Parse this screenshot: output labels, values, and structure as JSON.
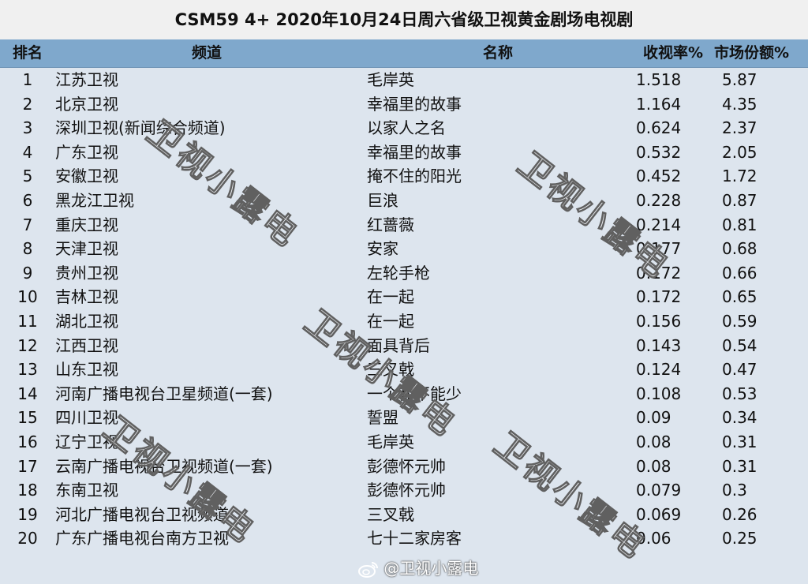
{
  "title": "CSM59 4+ 2020年10月24日周六省级卫视黄金剧场电视剧",
  "header": {
    "rank": "排名",
    "channel": "频道",
    "name": "名称",
    "rating": "收视率%",
    "share": "市场份额%"
  },
  "rows": [
    {
      "rank": "1",
      "channel": "江苏卫视",
      "name": "毛岸英",
      "rating": "1.518",
      "share": "5.87"
    },
    {
      "rank": "2",
      "channel": "北京卫视",
      "name": "幸福里的故事",
      "rating": "1.164",
      "share": "4.35"
    },
    {
      "rank": "3",
      "channel": "深圳卫视(新闻综合频道)",
      "name": "以家人之名",
      "rating": "0.624",
      "share": "2.37"
    },
    {
      "rank": "4",
      "channel": "广东卫视",
      "name": "幸福里的故事",
      "rating": "0.532",
      "share": "2.05"
    },
    {
      "rank": "5",
      "channel": "安徽卫视",
      "name": "掩不住的阳光",
      "rating": "0.452",
      "share": "1.72"
    },
    {
      "rank": "6",
      "channel": "黑龙江卫视",
      "name": "巨浪",
      "rating": "0.228",
      "share": "0.87"
    },
    {
      "rank": "7",
      "channel": "重庆卫视",
      "name": "红蔷薇",
      "rating": "0.214",
      "share": "0.81"
    },
    {
      "rank": "8",
      "channel": "天津卫视",
      "name": "安家",
      "rating": "0.177",
      "share": "0.68"
    },
    {
      "rank": "9",
      "channel": "贵州卫视",
      "name": "左轮手枪",
      "rating": "0.172",
      "share": "0.66"
    },
    {
      "rank": "10",
      "channel": "吉林卫视",
      "name": "在一起",
      "rating": "0.172",
      "share": "0.65"
    },
    {
      "rank": "11",
      "channel": "湖北卫视",
      "name": "在一起",
      "rating": "0.156",
      "share": "0.59"
    },
    {
      "rank": "12",
      "channel": "江西卫视",
      "name": "面具背后",
      "rating": "0.143",
      "share": "0.54"
    },
    {
      "rank": "13",
      "channel": "山东卫视",
      "name": "三叉戟",
      "rating": "0.124",
      "share": "0.47"
    },
    {
      "rank": "14",
      "channel": "河南广播电视台卫星频道(一套)",
      "name": "一个都不能少",
      "rating": "0.108",
      "share": "0.53"
    },
    {
      "rank": "15",
      "channel": "四川卫视",
      "name": "誓盟",
      "rating": "0.09",
      "share": "0.34"
    },
    {
      "rank": "16",
      "channel": "辽宁卫视",
      "name": "毛岸英",
      "rating": "0.08",
      "share": "0.31"
    },
    {
      "rank": "17",
      "channel": "云南广播电视台卫视频道(一套)",
      "name": "彭德怀元帅",
      "rating": "0.08",
      "share": "0.31"
    },
    {
      "rank": "18",
      "channel": "东南卫视",
      "name": "彭德怀元帅",
      "rating": "0.079",
      "share": "0.3"
    },
    {
      "rank": "19",
      "channel": "河北广播电视台卫视频道",
      "name": "三叉戟",
      "rating": "0.069",
      "share": "0.26"
    },
    {
      "rank": "20",
      "channel": "广东广播电视台南方卫视",
      "name": "七十二家房客",
      "rating": "0.06",
      "share": "0.25"
    }
  ],
  "watermark": "卫视小露电",
  "credit": "@卫视小露电",
  "credit_icon": "weibo-icon",
  "colors": {
    "header_bg": "#7fa8cc",
    "row_bg": "#dde5ee",
    "title_bg": "#f0f0f0"
  }
}
